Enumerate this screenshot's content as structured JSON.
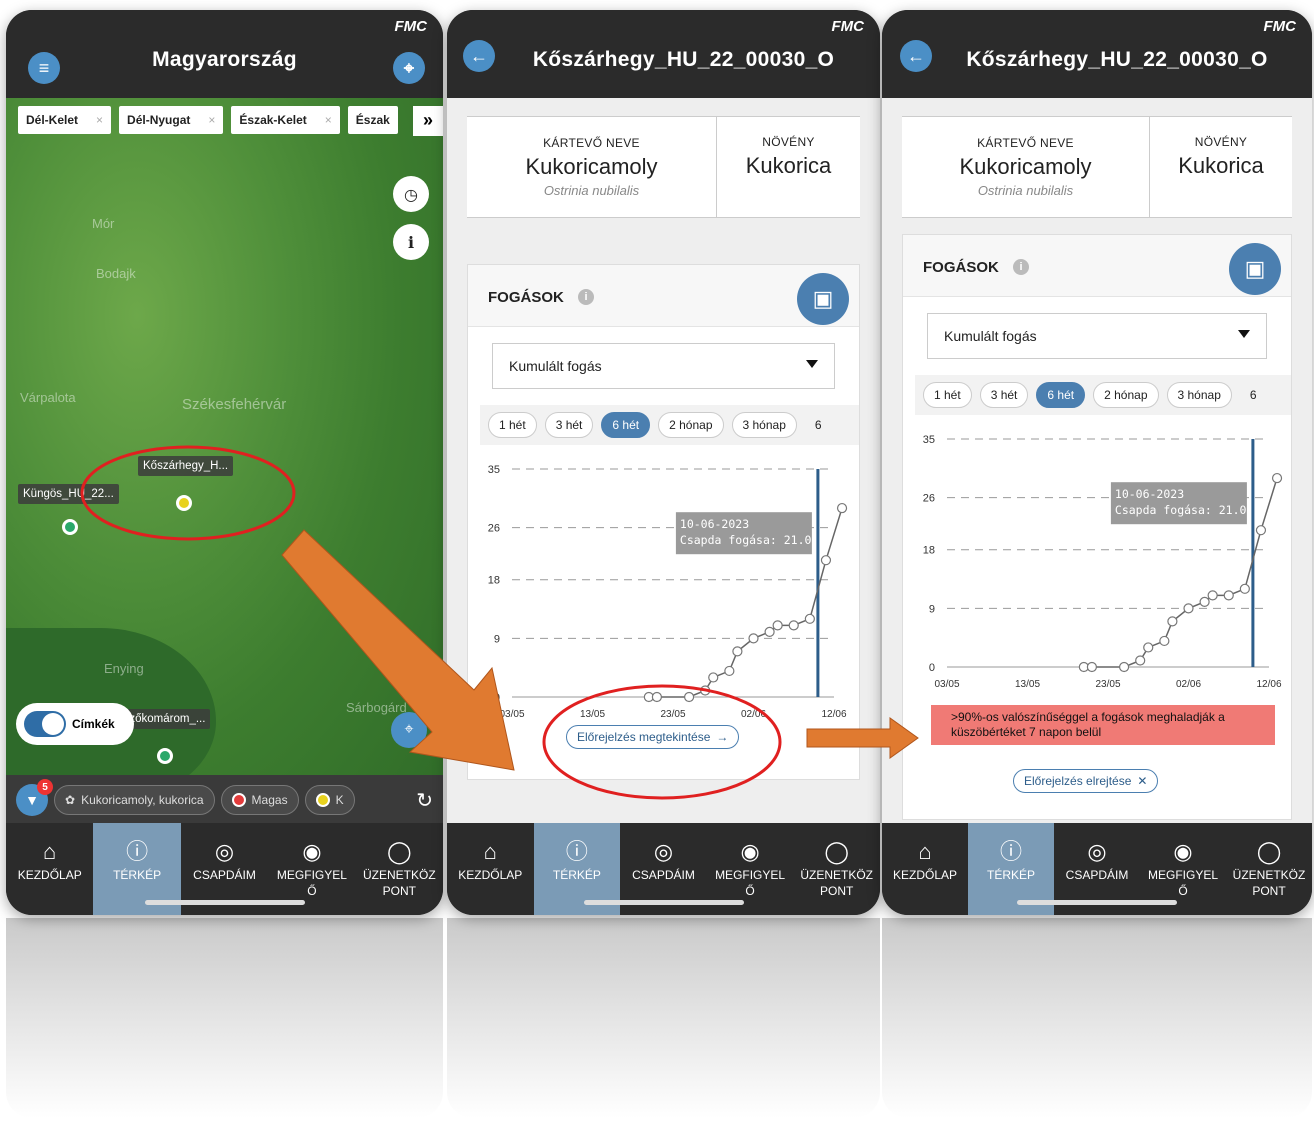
{
  "map_screen": {
    "brand": "FMC",
    "title": "Magyarország",
    "region_chips": [
      {
        "label": "Dél-Kelet"
      },
      {
        "label": "Dél-Nyugat"
      },
      {
        "label": "Észak-Kelet"
      },
      {
        "label": "Észak"
      }
    ],
    "more_chips_icon": "double-chevron-right-icon",
    "city_labels": [
      "Mór",
      "Bodajk",
      "Várpalota",
      "Székesfehérvár",
      "Enying",
      "Sárbogárd"
    ],
    "pins": [
      {
        "label": "Kőszárhegy_H...",
        "color": "#e8d21e"
      },
      {
        "label": "Küngös_HU_22...",
        "color": "#2aa86a"
      },
      {
        "label": "ezőkomárom_...",
        "color": "#2aa86a"
      }
    ],
    "labels_toggle": "Címkék",
    "filter_count": "5",
    "filter_chips": [
      {
        "label": "Kukoricamoly, kukorica"
      },
      {
        "label": "Magas",
        "color": "#e33b3b"
      },
      {
        "label": "K",
        "color": "#e8d21e"
      }
    ]
  },
  "detail": {
    "brand": "FMC",
    "title": "Kőszárhegy_HU_22_00030_O",
    "pest_label": "KÁRTEVŐ NEVE",
    "pest_name": "Kukoricamoly",
    "pest_latin": "Ostrinia nubilalis",
    "crop_label": "NÖVÉNY",
    "crop_name": "Kukorica",
    "catches_title": "FOGÁSOK",
    "select_value": "Kumulált fogás",
    "periods": [
      "1 hét",
      "3 hét",
      "6 hét",
      "2 hónap",
      "3 hónap",
      "6"
    ],
    "active_period": "6 hét",
    "tooltip_date": "10-06-2023",
    "tooltip_value": "Csapda fogása: 21.0",
    "forecast_show": "Előrejelzés megtekintése",
    "forecast_hide": "Előrejelzés elrejtése",
    "alert_text": ">90%-os valószínűséggel a fogások meghaladják a küszöbértéket 7 napon belül"
  },
  "chart_data": {
    "type": "line",
    "title": "",
    "xlabel": "",
    "ylabel": "",
    "y_ticks": [
      "0",
      "9",
      "18",
      "26",
      "35"
    ],
    "x_ticks": [
      "03/05",
      "13/05",
      "23/05",
      "02/06",
      "12/06"
    ],
    "ylim": [
      0,
      35
    ],
    "grid": true,
    "x": [
      "20/05",
      "21/05",
      "25/05",
      "27/05",
      "28/05",
      "30/05",
      "31/05",
      "02/06",
      "04/06",
      "05/06",
      "07/06",
      "09/06",
      "11/06",
      "13/06"
    ],
    "series": [
      {
        "values": [
          0,
          0,
          0,
          1,
          3,
          4,
          7,
          9,
          10,
          11,
          11,
          12,
          21,
          29
        ]
      }
    ],
    "highlight": {
      "x": "10/06",
      "value": 21.0
    }
  },
  "nav": {
    "items": [
      {
        "label": "KEZDŐLAP",
        "icon": "home-icon"
      },
      {
        "label": "TÉRKÉP",
        "icon": "map-pin-icon"
      },
      {
        "label": "CSAPDÁIM",
        "icon": "trap-icon"
      },
      {
        "label": "MEGFIGYELŐ",
        "icon": "bug-search-icon"
      },
      {
        "label": "ÜZENETKÖZPONT",
        "icon": "chat-icon"
      }
    ],
    "active": "TÉRKÉP"
  },
  "colors": {
    "accent": "#4b7fb0",
    "header": "#2b2b2b",
    "alert": "#f07a75",
    "arrow": "#e07a30",
    "highlight_circle": "#e02020"
  }
}
